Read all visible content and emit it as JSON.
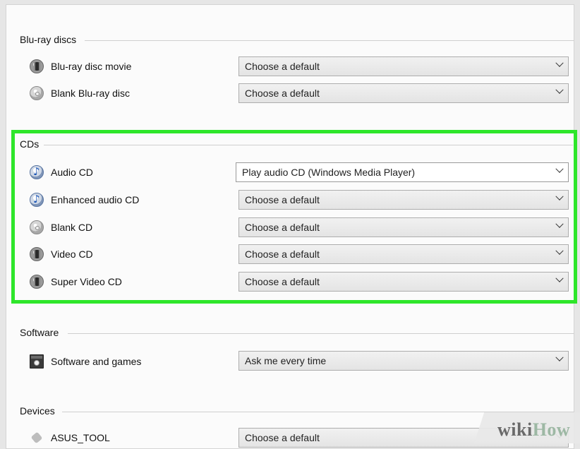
{
  "sections": {
    "bluray": {
      "label": "Blu-ray discs",
      "rows": [
        {
          "label": "Blu-ray disc movie",
          "icon": "movie-disc-icon",
          "value": "Choose a default"
        },
        {
          "label": "Blank Blu-ray disc",
          "icon": "blank-disc-icon",
          "value": "Choose a default"
        }
      ]
    },
    "cds": {
      "label": "CDs",
      "rows": [
        {
          "label": "Audio CD",
          "icon": "audio-disc-icon",
          "value": "Play audio CD (Windows Media Player)"
        },
        {
          "label": "Enhanced audio CD",
          "icon": "audio-disc-icon",
          "value": "Choose a default"
        },
        {
          "label": "Blank CD",
          "icon": "blank-disc-icon",
          "value": "Choose a default"
        },
        {
          "label": "Video CD",
          "icon": "movie-disc-icon",
          "value": "Choose a default"
        },
        {
          "label": "Super Video CD",
          "icon": "movie-disc-icon",
          "value": "Choose a default"
        }
      ]
    },
    "software": {
      "label": "Software",
      "rows": [
        {
          "label": "Software and games",
          "icon": "software-icon",
          "value": "Ask me every time"
        }
      ]
    },
    "devices": {
      "label": "Devices",
      "rows": [
        {
          "label": "ASUS_TOOL",
          "icon": "usb-device-icon",
          "value": "Choose a default"
        }
      ]
    }
  },
  "highlight_color": "#2ee62a",
  "watermark": {
    "wiki": "wiki",
    "how": "How"
  }
}
